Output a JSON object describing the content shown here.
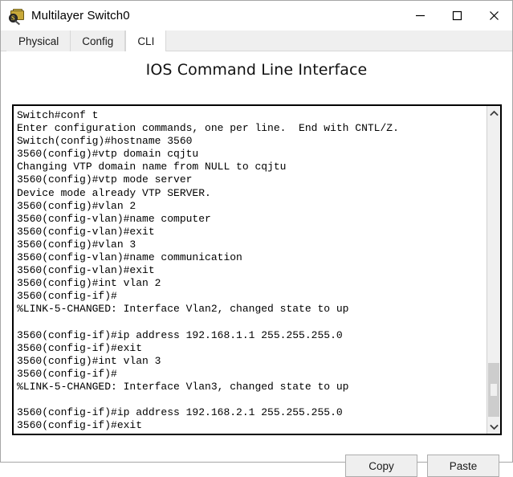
{
  "window": {
    "title": "Multilayer Switch0",
    "icon": "packet-tracer-device-icon",
    "controls": [
      {
        "name": "minimize",
        "glyph": "minimize-icon"
      },
      {
        "name": "maximize",
        "glyph": "maximize-icon"
      },
      {
        "name": "close",
        "glyph": "close-icon"
      }
    ]
  },
  "tabs": [
    {
      "label": "Physical",
      "active": false
    },
    {
      "label": "Config",
      "active": false
    },
    {
      "label": "CLI",
      "active": true
    }
  ],
  "cli": {
    "heading": "IOS Command Line Interface",
    "text": "Switch#conf t\nEnter configuration commands, one per line.  End with CNTL/Z.\nSwitch(config)#hostname 3560\n3560(config)#vtp domain cqjtu\nChanging VTP domain name from NULL to cqjtu\n3560(config)#vtp mode server\nDevice mode already VTP SERVER.\n3560(config)#vlan 2\n3560(config-vlan)#name computer\n3560(config-vlan)#exit\n3560(config)#vlan 3\n3560(config-vlan)#name communication\n3560(config-vlan)#exit\n3560(config)#int vlan 2\n3560(config-if)#\n%LINK-5-CHANGED: Interface Vlan2, changed state to up\n\n3560(config-if)#ip address 192.168.1.1 255.255.255.0\n3560(config-if)#exit\n3560(config)#int vlan 3\n3560(config-if)#\n%LINK-5-CHANGED: Interface Vlan3, changed state to up\n\n3560(config-if)#ip address 192.168.2.1 255.255.255.0\n3560(config-if)#exit",
    "scrollbar": {
      "up_arrow": "chevron-up-icon",
      "down_arrow": "chevron-down-icon"
    }
  },
  "footer": {
    "copy_label": "Copy",
    "paste_label": "Paste"
  },
  "colors": {
    "window_border": "#a6a6a6",
    "tabstrip_bg": "#efefef",
    "terminal_border": "#000000",
    "terminal_text": "#000000",
    "button_bg": "#efefef",
    "scroll_thumb": "#cdcdcd"
  }
}
